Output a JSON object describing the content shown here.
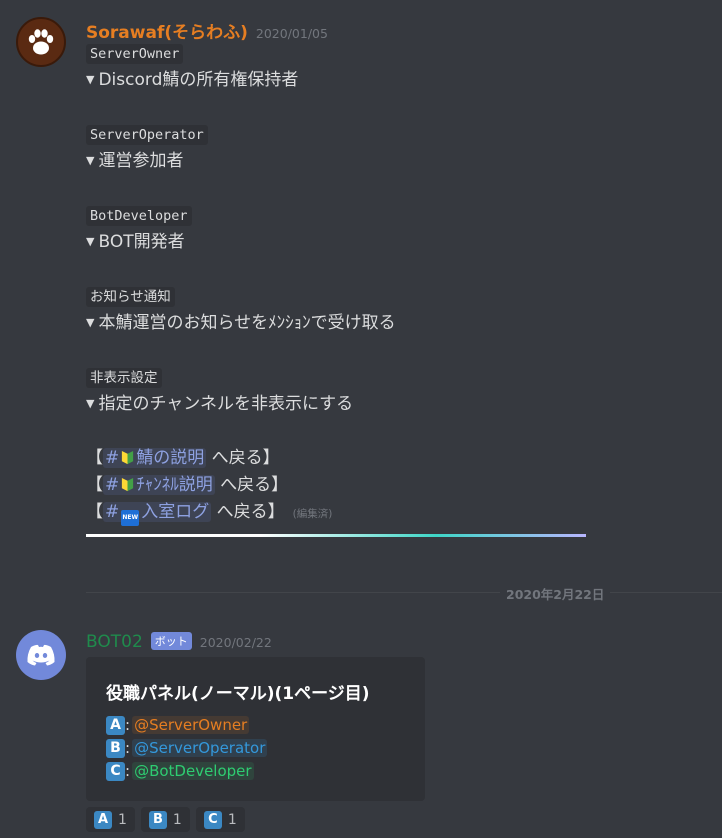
{
  "message1": {
    "username": "Sorawaf(そらわふ)",
    "username_color": "#e67e22",
    "timestamp": "2020/01/05",
    "blocks": [
      {
        "code": "ServerOwner",
        "desc": "Discord鯖の所有権保持者"
      },
      {
        "code": "ServerOperator",
        "desc": "運営参加者"
      },
      {
        "code": "BotDeveloper",
        "desc": "BOT開発者"
      },
      {
        "code": "お知らせ通知",
        "desc": "本鯖運営のお知らせをﾒﾝｼｮﾝで受け取る"
      },
      {
        "code": "非表示設定",
        "desc": "指定のチャンネルを非表示にする"
      }
    ],
    "links": [
      {
        "open": "【",
        "channel": "#🔰鯖の説明",
        "channel_text": "鯖の説明",
        "close": " へ戻る】"
      },
      {
        "open": "【",
        "channel": "#🔰ﾁｬﾝﾈﾙ説明",
        "channel_text": "ﾁｬﾝﾈﾙ説明",
        "close": " へ戻る】"
      },
      {
        "open": "【",
        "channel": "#🆕入室ログ",
        "channel_text": "入室ログ",
        "close": " へ戻る】"
      }
    ],
    "hash": "#",
    "new_emoji_text": "NEW",
    "edited": "(編集済)"
  },
  "date_divider": "2020年2月22日",
  "message2": {
    "username": "BOT02",
    "username_color": "#1f8b4c",
    "bot_tag": "ボット",
    "timestamp": "2020/02/22",
    "embed": {
      "title": "役職パネル(ノーマル)(1ページ目)",
      "rows": [
        {
          "key": "A",
          "mention": "@ServerOwner",
          "color": "#e67e22",
          "bg": "rgba(230,126,34,0.12)"
        },
        {
          "key": "B",
          "mention": "@ServerOperator",
          "color": "#3498db",
          "bg": "rgba(52,152,219,0.15)"
        },
        {
          "key": "C",
          "mention": "@BotDeveloper",
          "color": "#2ecc71",
          "bg": "rgba(46,204,113,0.12)"
        }
      ]
    },
    "reactions": [
      {
        "key": "A",
        "count": "1"
      },
      {
        "key": "B",
        "count": "1"
      },
      {
        "key": "C",
        "count": "1"
      }
    ]
  },
  "colors": {
    "background": "#36393f",
    "code_bg": "#2f3136",
    "channel_link": "#8ea1e1",
    "blurple": "#7289da"
  },
  "icons": {
    "avatar1": "paw-icon",
    "avatar2": "discord-logo-icon",
    "triangle": "triangle-down-icon"
  }
}
